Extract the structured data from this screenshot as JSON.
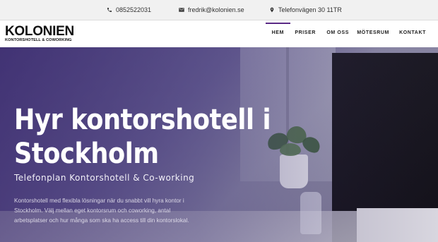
{
  "topbar": {
    "phone": "0852522031",
    "email": "fredrik@kolonien.se",
    "address": "Telefonvägen 30 11TR"
  },
  "header": {
    "logo_main": "KOLONIEN",
    "logo_sub": "KONTORSHOTELL & COWORKING",
    "nav": [
      {
        "label": "HEM",
        "active": true
      },
      {
        "label": "PRISER",
        "active": false
      },
      {
        "label": "OM OSS",
        "active": false
      },
      {
        "label": "MÖTESRUM",
        "active": false
      },
      {
        "label": "KONTAKT",
        "active": false
      }
    ]
  },
  "hero": {
    "title": "Hyr kontorshotell i Stockholm",
    "subtitle": "Telefonplan Kontorshotell & Co-working",
    "body": "Kontorshotell med flexibla lösningar när du snabbt vill hyra kontor i Stockholm. Välj mellan eget kontorsrum och coworking, antal arbetsplatser och hur många som ska ha access till din kontorslokal."
  },
  "colors": {
    "accent": "#5b2a86",
    "topbar_bg": "#f1f1f1",
    "hero_overlay": "#4a3c7e"
  },
  "icons": {
    "phone": "phone-icon",
    "email": "envelope-icon",
    "address": "map-pin-icon"
  }
}
